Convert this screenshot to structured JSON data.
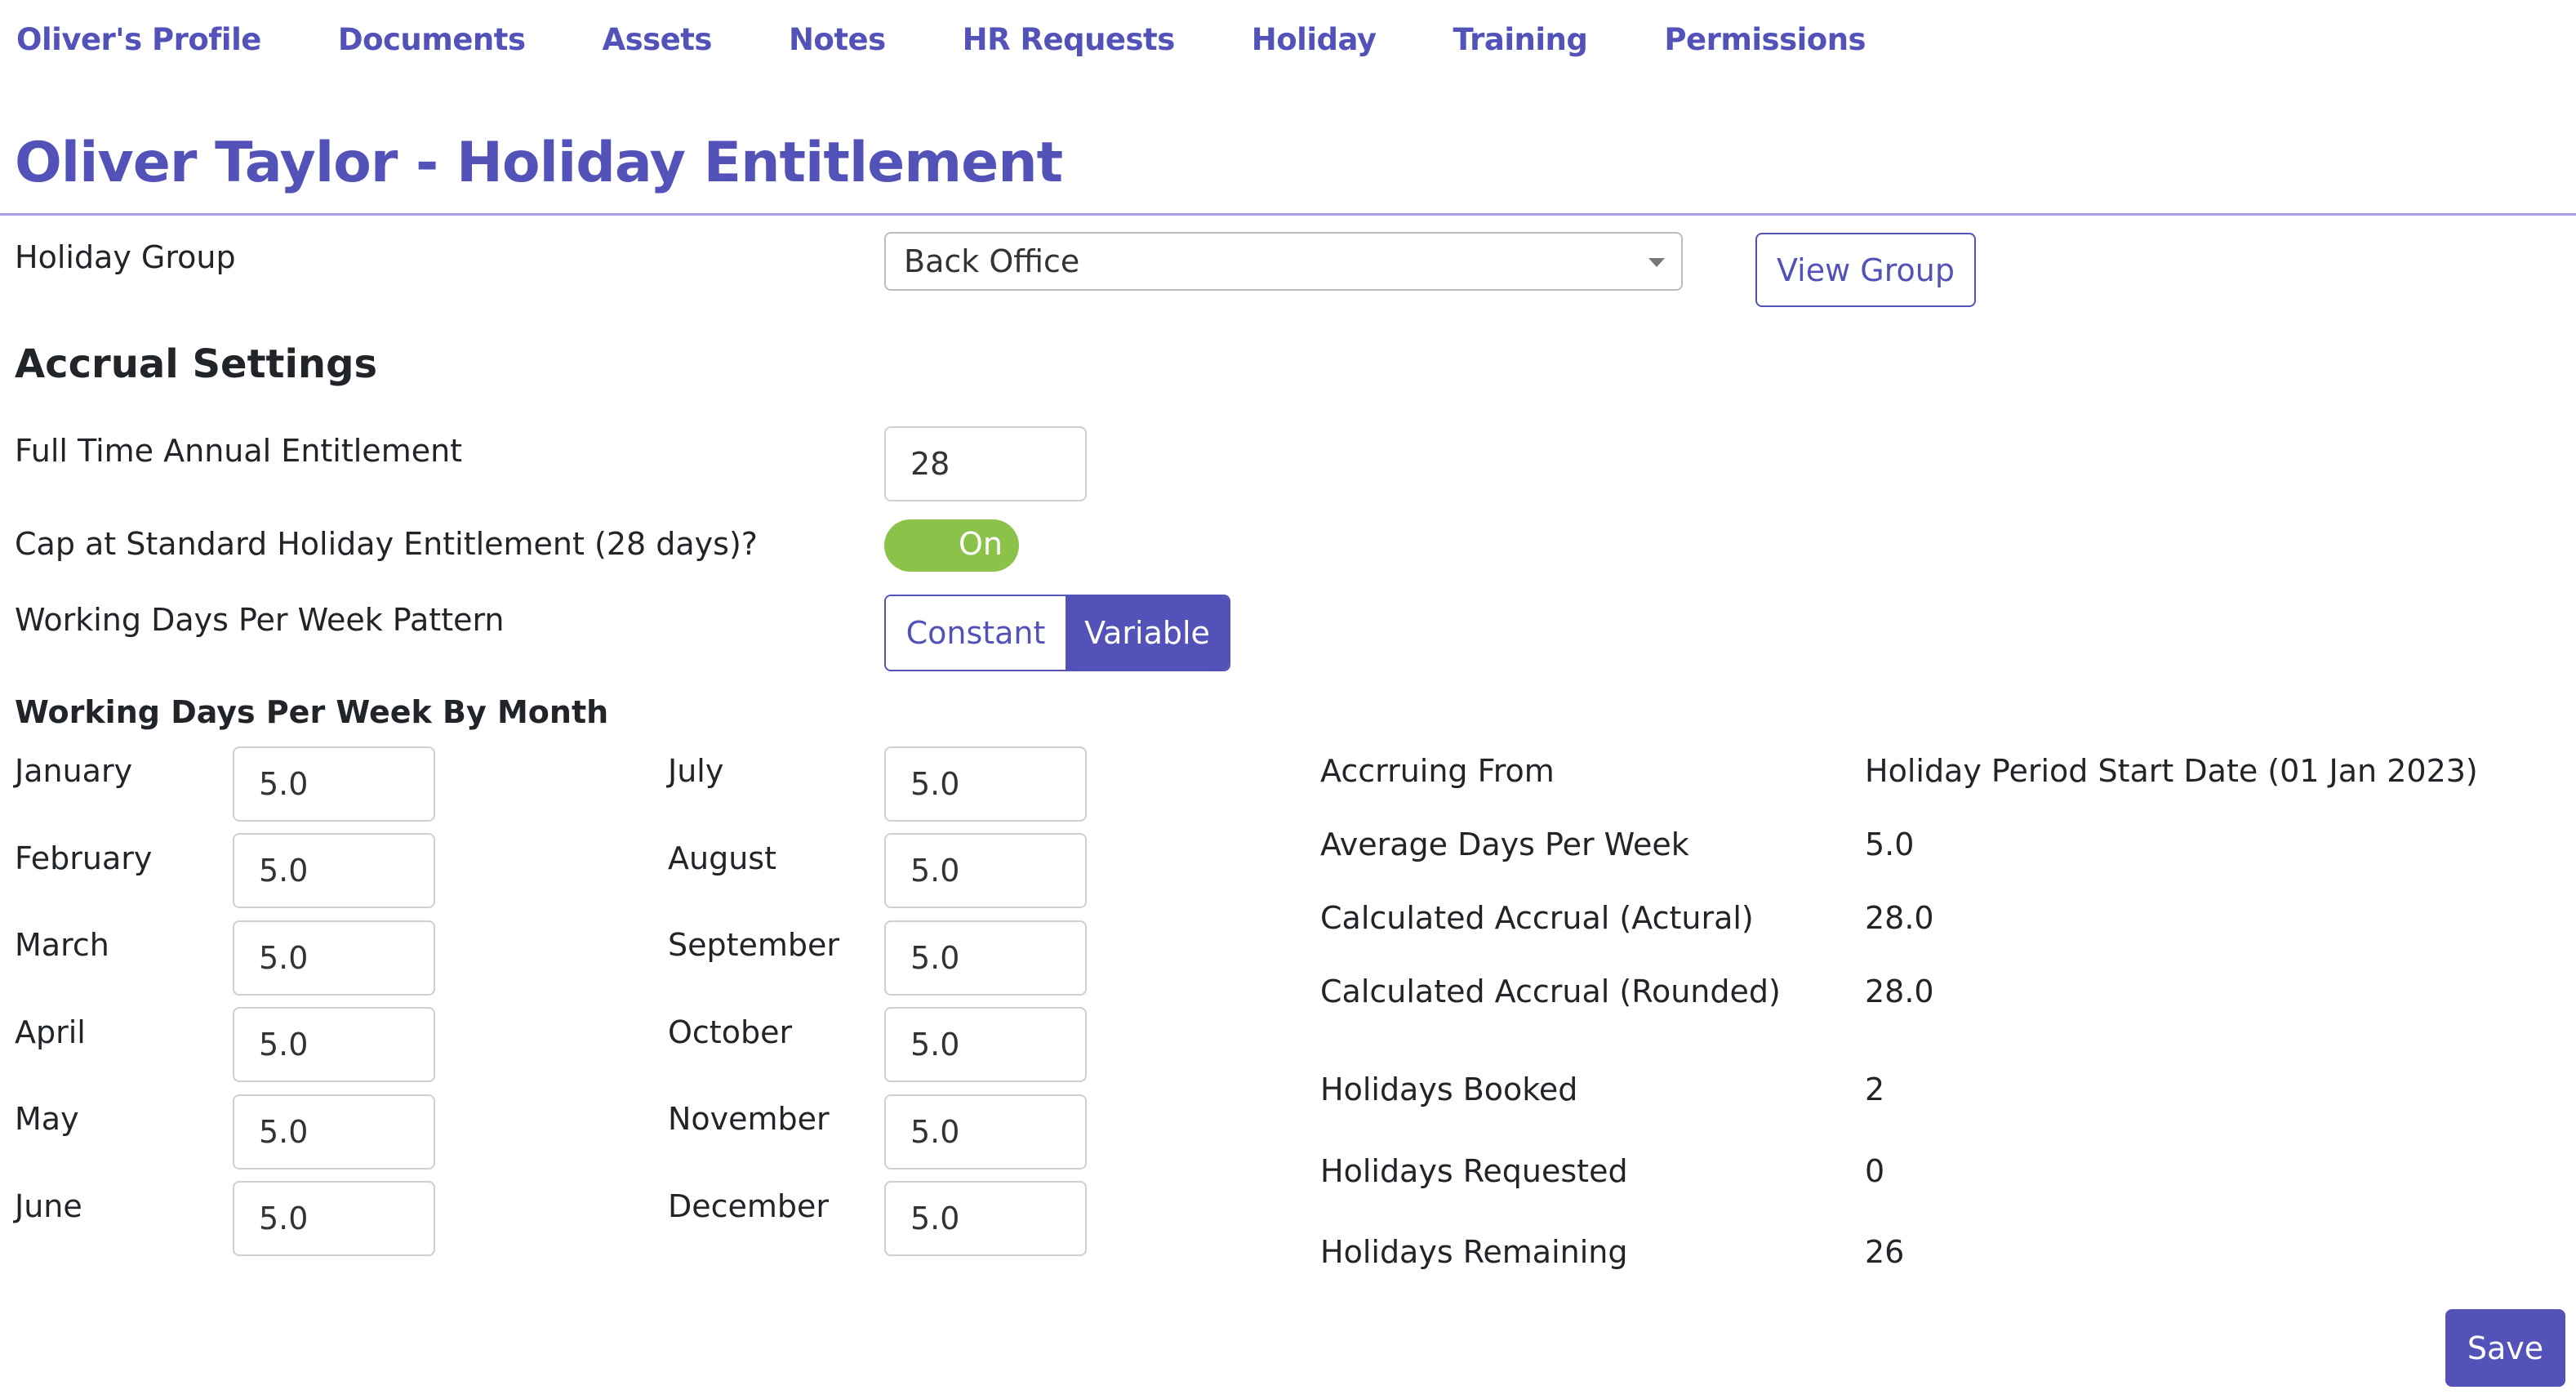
{
  "nav": [
    "Oliver's Profile",
    "Documents",
    "Assets",
    "Notes",
    "HR Requests",
    "Holiday",
    "Training",
    "Permissions"
  ],
  "page_title": "Oliver Taylor - Holiday Entitlement",
  "holiday_group": {
    "label": "Holiday Group",
    "value": "Back Office",
    "view_button": "View Group"
  },
  "accrual": {
    "heading": "Accrual Settings",
    "full_time_label": "Full Time Annual Entitlement",
    "full_time_value": "28",
    "cap_label": "Cap at Standard Holiday Entitlement (28 days)?",
    "cap_toggle": "On",
    "pattern_label": "Working Days Per Week Pattern",
    "pattern_options": [
      "Constant",
      "Variable"
    ],
    "pattern_selected": "Variable"
  },
  "by_month": {
    "heading": "Working Days Per Week By Month",
    "months": [
      {
        "name": "January",
        "value": "5.0"
      },
      {
        "name": "February",
        "value": "5.0"
      },
      {
        "name": "March",
        "value": "5.0"
      },
      {
        "name": "April",
        "value": "5.0"
      },
      {
        "name": "May",
        "value": "5.0"
      },
      {
        "name": "June",
        "value": "5.0"
      },
      {
        "name": "July",
        "value": "5.0"
      },
      {
        "name": "August",
        "value": "5.0"
      },
      {
        "name": "September",
        "value": "5.0"
      },
      {
        "name": "October",
        "value": "5.0"
      },
      {
        "name": "November",
        "value": "5.0"
      },
      {
        "name": "December",
        "value": "5.0"
      }
    ]
  },
  "summary": [
    {
      "label": "Accrruing From",
      "value": "Holiday Period Start Date (01 Jan 2023)"
    },
    {
      "label": "Average Days Per Week",
      "value": "5.0"
    },
    {
      "label": "Calculated Accrual (Actural)",
      "value": "28.0"
    },
    {
      "label": "Calculated Accrual (Rounded)",
      "value": "28.0"
    },
    {
      "label": "Holidays Booked",
      "value": "2"
    },
    {
      "label": "Holidays Requested",
      "value": "0"
    },
    {
      "label": "Holidays Remaining",
      "value": "26"
    }
  ],
  "save_label": "Save",
  "colors": {
    "accent": "#5352b8",
    "toggle_on": "#8bc34a",
    "rule": "#a9a0e6"
  }
}
